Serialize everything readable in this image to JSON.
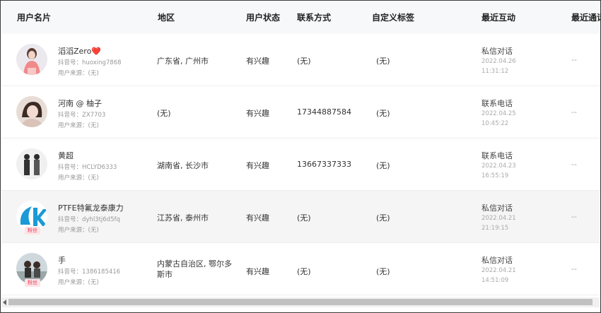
{
  "columns": {
    "name": "用户名片",
    "region": "地区",
    "status": "用户状态",
    "contact": "联系方式",
    "tags": "自定义标签",
    "recent": "最近互动",
    "call": "最近通话"
  },
  "rows": [
    {
      "name": "滔滔Zero❤️",
      "douyin": "抖音号：huoxing7868",
      "source": "用户来源：(无)",
      "region": "广东省, 广州市",
      "status": "有兴趣",
      "contact": "(无)",
      "tags": "(无)",
      "action": "私信对话",
      "date": "2022.04.26",
      "time": "11:31:12",
      "call": "--",
      "fan": false
    },
    {
      "name": "河南 @ 柚子",
      "douyin": "抖音号：ZX7703",
      "source": "用户来源：(无)",
      "region": "(无)",
      "status": "有兴趣",
      "contact": "17344887584",
      "tags": "(无)",
      "action": "联系电话",
      "date": "2022.04.25",
      "time": "10:45:22",
      "call": "--",
      "fan": false
    },
    {
      "name": "黄超",
      "douyin": "抖音号：HCLYD6333",
      "source": "用户来源：(无)",
      "region": "湖南省, 长沙市",
      "status": "有兴趣",
      "contact": "13667337333",
      "tags": "(无)",
      "action": "联系电话",
      "date": "2022.04.23",
      "time": "16:55:19",
      "call": "--",
      "fan": false
    },
    {
      "name": "PTFE特氟龙泰康力",
      "douyin": "抖音号：dyhl3tj6d5fq",
      "source": "用户来源：(无)",
      "region": "江苏省, 泰州市",
      "status": "有兴趣",
      "contact": "(无)",
      "tags": "(无)",
      "action": "私信对话",
      "date": "2022.04.21",
      "time": "21:19:15",
      "call": "--",
      "fan": true,
      "fan_label": "粉丝"
    },
    {
      "name": "手",
      "douyin": "抖音号：1386185416",
      "source": "用户来源：(无)",
      "region": "内蒙古自治区, 鄂尔多斯市",
      "status": "有兴趣",
      "contact": "(无)",
      "tags": "(无)",
      "action": "私信对话",
      "date": "2022.04.21",
      "time": "14:51:09",
      "call": "--",
      "fan": true,
      "fan_label": "粉丝"
    }
  ],
  "colors": {
    "header_bg": "#f7f8fa",
    "alt_row_bg": "#f5f5f5",
    "fan_badge_bg": "#fde3e6",
    "fan_badge_text": "#ea3e5a"
  }
}
